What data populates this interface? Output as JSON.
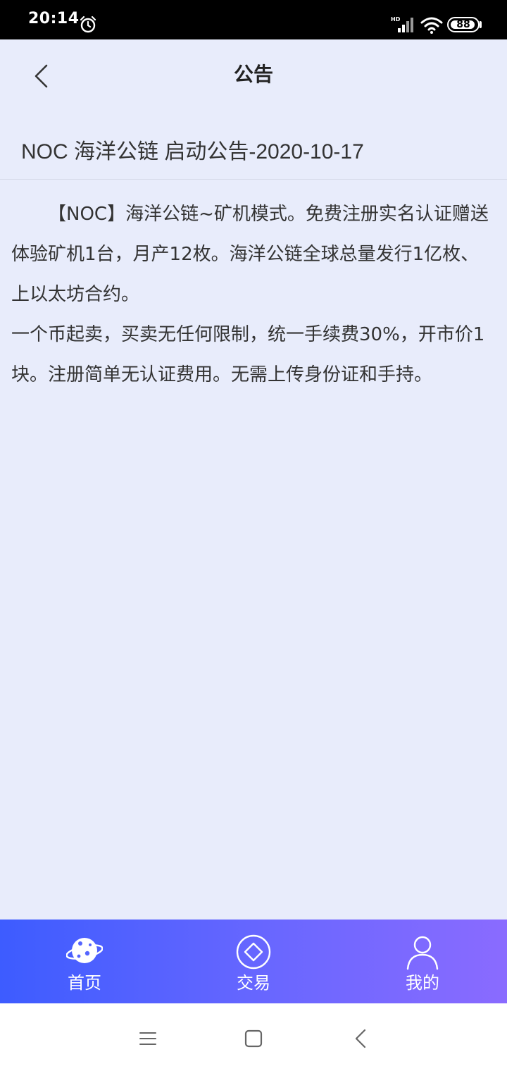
{
  "status_bar": {
    "time": "20:14",
    "battery": "88",
    "network_label": "HD"
  },
  "header": {
    "title": "公告",
    "back_icon": "chevron-left-icon"
  },
  "notice": {
    "title": "NOC 海洋公链 启动公告-2020-10-17",
    "paragraphs": [
      "【NOC】海洋公链~矿机模式。免费注册实名认证赠送体验矿机1台，月产12枚。海洋公链全球总量发行1亿枚、上以太坊合约。",
      "一个币起卖，买卖无任何限制，统一手续费30%，开市价1块。注册简单无认证费用。无需上传身份证和手持。"
    ]
  },
  "bottom_nav": {
    "items": [
      {
        "label": "首页",
        "icon": "planet-icon"
      },
      {
        "label": "交易",
        "icon": "diamond-circle-icon"
      },
      {
        "label": "我的",
        "icon": "user-icon"
      }
    ]
  },
  "colors": {
    "background": "#e8ecfb",
    "nav_gradient_start": "#3d5cff",
    "nav_gradient_end": "#8a6bff"
  }
}
